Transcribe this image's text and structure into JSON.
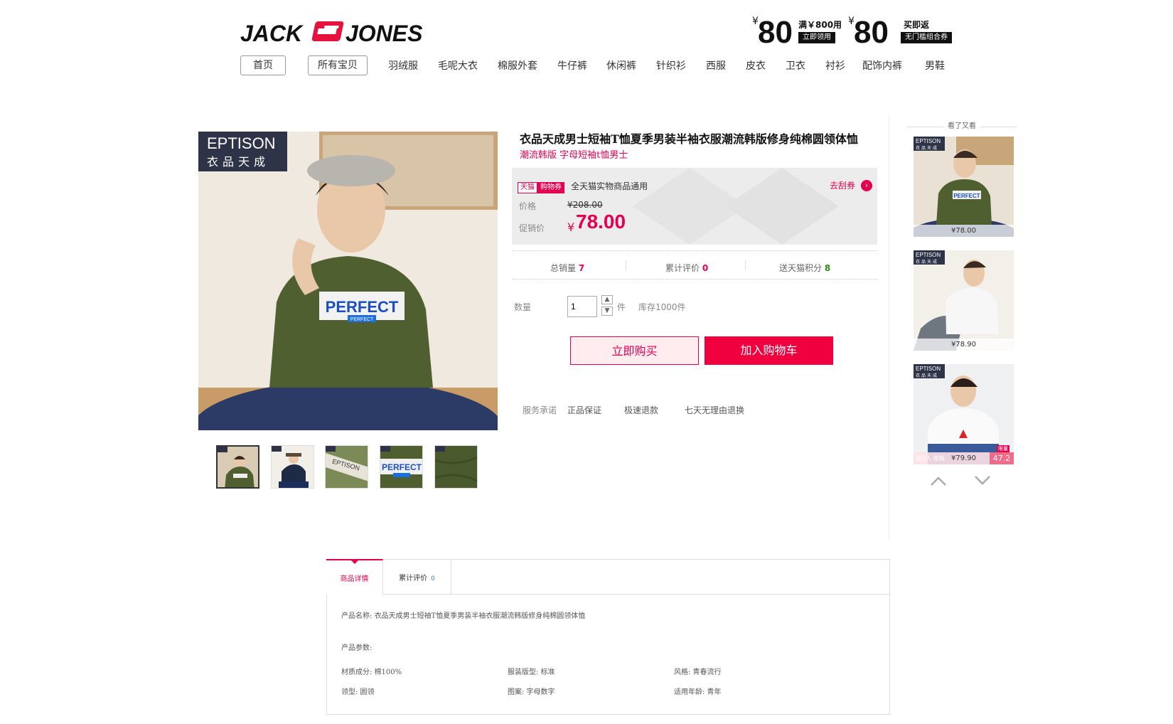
{
  "header": {
    "brand": "JACK JONES",
    "promo1": {
      "currency": "¥",
      "amount": "80",
      "condition": "满￥800用",
      "action": "立即领用"
    },
    "promo2": {
      "currency": "¥",
      "amount": "80",
      "condition": "买即返",
      "action": "无门槛组合券"
    }
  },
  "nav": {
    "items": [
      "首页",
      "所有宝贝",
      "羽绒服",
      "毛呢大衣",
      "棉服外套",
      "牛仔裤",
      "休闲裤",
      "针织衫",
      "西服",
      "皮衣",
      "卫衣",
      "衬衫",
      "配饰内裤",
      "男鞋"
    ]
  },
  "gallery": {
    "brand_en": "EPTISON",
    "brand_cn": "衣品天成",
    "shirt_text": "PERFECT",
    "shirt_subtext": "PERFECT",
    "thumb_count": 5
  },
  "product": {
    "title": "衣品天成男士短袖T恤夏季男装半袖衣服潮流韩版修身纯棉圆领体恤",
    "subtitle": "潮流韩版 字母短袖t恤男士",
    "coupon": {
      "tag1": "天猫",
      "tag2": "购物券",
      "text": "全天猫实物商品通用",
      "link": "去刮券"
    },
    "price_label": "价格",
    "original_price": "¥208.00",
    "promo_label": "促销价",
    "promo_currency": "¥",
    "promo_price": "78.00",
    "stats": [
      {
        "label": "总销量",
        "value": "7"
      },
      {
        "label": "累计评价",
        "value": "0"
      },
      {
        "label": "送天猫积分",
        "value": "8"
      }
    ],
    "qty_label": "数量",
    "qty_value": "1",
    "qty_unit": "件",
    "stock": "库存1000件",
    "buy_label": "立即购买",
    "cart_label": "加入购物车",
    "service_label": "服务承诺",
    "services": [
      "正品保证",
      "极速退款",
      "七天无理由退换"
    ]
  },
  "rail": {
    "title": "看了又看",
    "items": [
      {
        "brand_en": "EPTISON",
        "brand_cn": "衣品天成",
        "price": "¥78.00"
      },
      {
        "brand_en": "EPTISON",
        "brand_cn": "衣品天成",
        "price": "¥78.90"
      },
      {
        "brand_en": "EPTISON",
        "brand_cn": "衣品天成",
        "price": "¥79.90",
        "badge_left": "超2人 抢购",
        "badge_right": "47.2",
        "badge_tag": "限量"
      }
    ]
  },
  "tabs": [
    {
      "label": "商品详情",
      "active": true
    },
    {
      "label": "累计评价",
      "count": "0"
    }
  ],
  "details": {
    "name_label": "产品名称:",
    "name_value": "衣品天成男士短袖T恤夏季男装半袖衣服潮流韩版修身纯棉圆领体恤",
    "params_label": "产品参数:",
    "params": [
      "材质成分: 棉100%",
      "服装版型: 标准",
      "风格: 青春流行",
      "领型: 圆领",
      "图案: 字母数字",
      "适用年龄: 青年"
    ]
  },
  "colors": {
    "accent": "#e5004f",
    "cart": "#f0003f",
    "green_shirt": "#4f5f30"
  }
}
